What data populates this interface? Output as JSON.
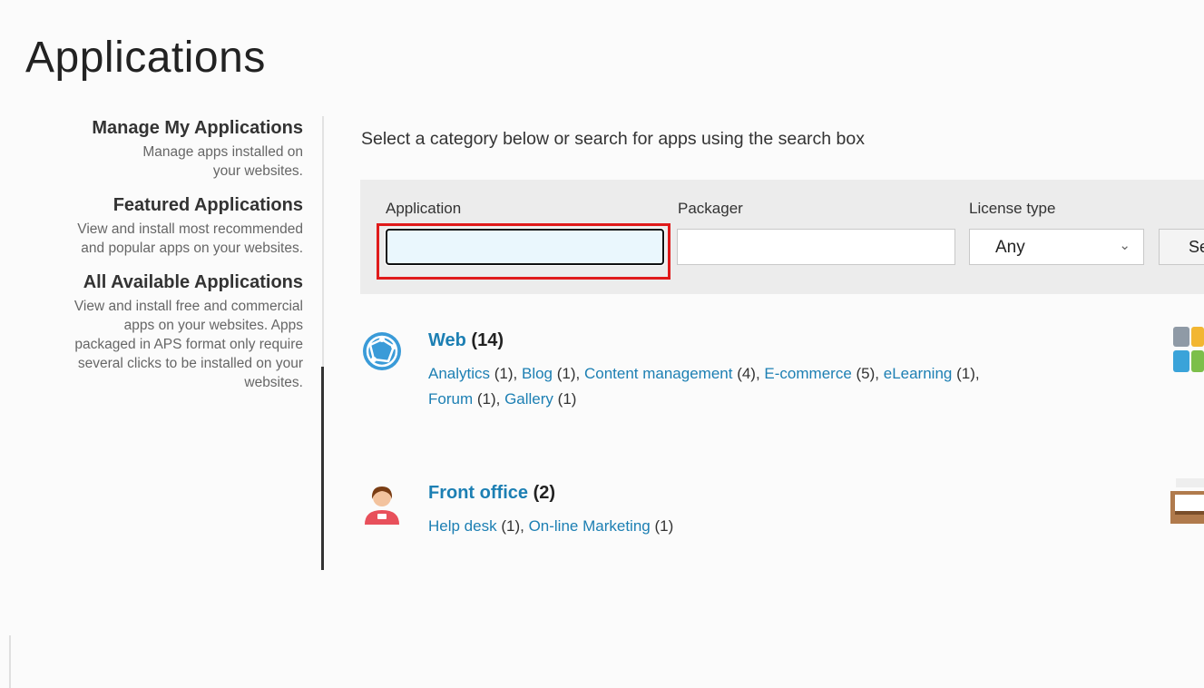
{
  "page": {
    "title": "Applications"
  },
  "sidebar": {
    "items": [
      {
        "title": "Manage My Applications",
        "desc": "Manage apps installed on your websites."
      },
      {
        "title": "Featured Applications",
        "desc": "View and install most recommended and popular apps on your websites."
      },
      {
        "title": "All Available Applications",
        "desc": "View and install free and commercial apps on your websites. Apps packaged in APS format only require several clicks to be installed on your websites."
      }
    ]
  },
  "main": {
    "hint": "Select a category below or search for apps using the search box",
    "filters": {
      "application_label": "Application",
      "application_value": "",
      "packager_label": "Packager",
      "packager_value": "",
      "license_label": "License type",
      "license_value": "Any",
      "search_button_label": "Se"
    },
    "categories": [
      {
        "name": "Web",
        "count": "(14)",
        "icon": "globe-icon",
        "links": [
          {
            "label": "Analytics",
            "count": " (1), "
          },
          {
            "label": "Blog",
            "count": " (1), "
          },
          {
            "label": "Content management",
            "count": " (4), "
          },
          {
            "label": "E-commerce",
            "count": " (5), "
          },
          {
            "label": "eLearning",
            "count": " (1),"
          },
          {
            "label": "Forum",
            "count": " (1), "
          },
          {
            "label": "Gallery",
            "count": " (1)"
          }
        ]
      },
      {
        "name": "Front office",
        "count": "(2)",
        "icon": "person-icon",
        "links": [
          {
            "label": "Help desk",
            "count": " (1), "
          },
          {
            "label": "On-line Marketing",
            "count": " (1)"
          }
        ]
      }
    ]
  },
  "colors": {
    "link": "#1c7fb3",
    "highlight": "#e01a1a",
    "focus_bg": "#eaf7fd"
  }
}
